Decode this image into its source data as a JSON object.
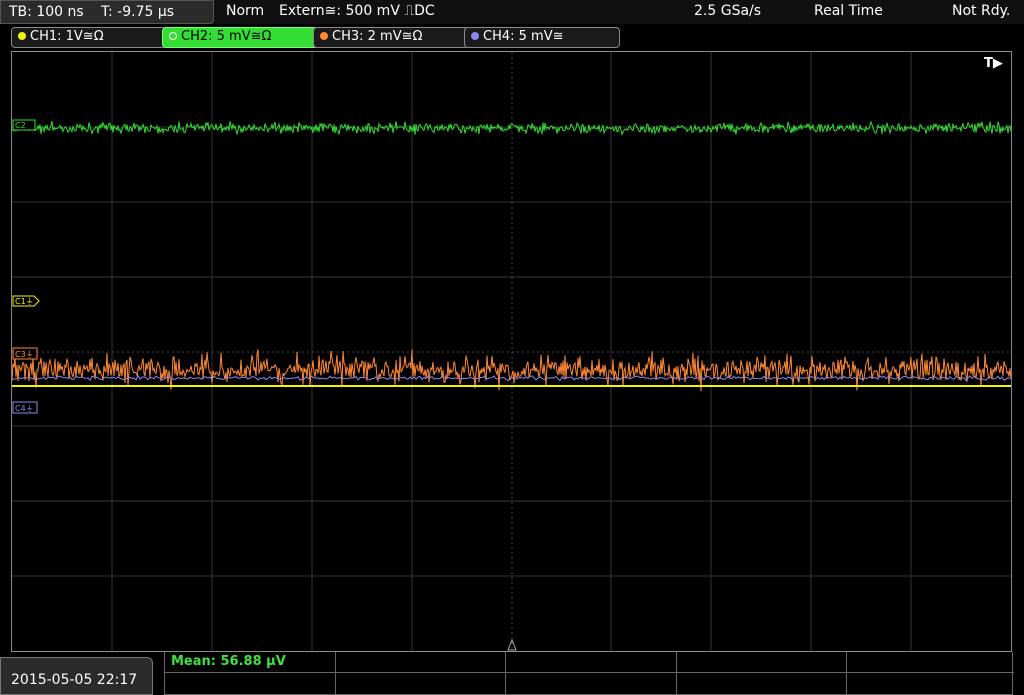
{
  "topbar": {
    "timebase": "TB: 100 ns",
    "trigger_offset": "T: -9.75 µs",
    "trigger_mode": "Norm",
    "trigger_source": "Extern≅: 500 mV ⎍DC",
    "sample_rate": "2.5 GSa/s",
    "acq_mode": "Real Time",
    "status": "Not Rdy."
  },
  "channels": [
    {
      "label": "CH1: 1V≅Ω",
      "color": "#f2f20a"
    },
    {
      "label": "CH2: 5 mV≅Ω",
      "color": "#33dd33"
    },
    {
      "label": "CH3: 2 mV≅Ω",
      "color": "#ff8833"
    },
    {
      "label": "CH4: 5 mV≅",
      "color": "#8888ee"
    }
  ],
  "markers": {
    "trigger_label": "T▶",
    "c1": "C1⏚",
    "c2": "C2",
    "c3": "C3⏚",
    "c4": "C4⏚"
  },
  "bottom": {
    "datetime": "2015-05-05 22:17",
    "measurement": "Mean: 56.88 µV"
  }
}
